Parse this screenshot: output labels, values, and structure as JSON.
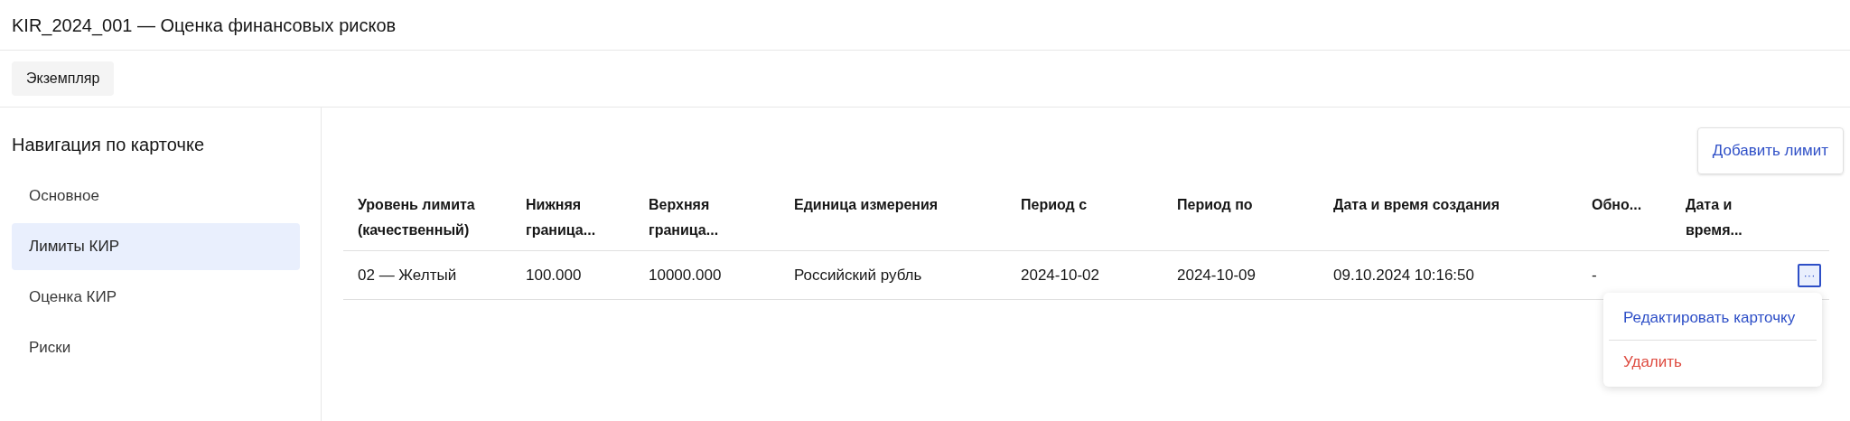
{
  "title": "KIR_2024_001 — Оценка финансовых рисков",
  "tabs": [
    {
      "label": "Экземпляр",
      "selected": true
    }
  ],
  "sidebar": {
    "heading": "Навигация по карточке",
    "items": [
      {
        "label": "Основное",
        "selected": false
      },
      {
        "label": "Лимиты КИР",
        "selected": true
      },
      {
        "label": "Оценка КИР",
        "selected": false
      },
      {
        "label": "Риски",
        "selected": false
      }
    ]
  },
  "add_button": "Добавить лимит",
  "table": {
    "columns": [
      "Уровень лимита (качественный)",
      "Нижняя граница...",
      "Верхняя граница...",
      "Единица измерения",
      "Период с",
      "Период по",
      "Дата и время создания",
      "Обно...",
      "Дата и время..."
    ],
    "rows": [
      {
        "cells": [
          "02 — Желтый",
          "100.000",
          "10000.000",
          "Российский рубль",
          "2024-10-02",
          "2024-10-09",
          "09.10.2024 10:16:50",
          "-",
          ""
        ],
        "menu_open": true
      }
    ]
  },
  "row_menu": [
    {
      "label": "Редактировать карточку",
      "kind": "normal"
    },
    {
      "label": "Удалить",
      "kind": "danger"
    }
  ],
  "menu_button": "···"
}
